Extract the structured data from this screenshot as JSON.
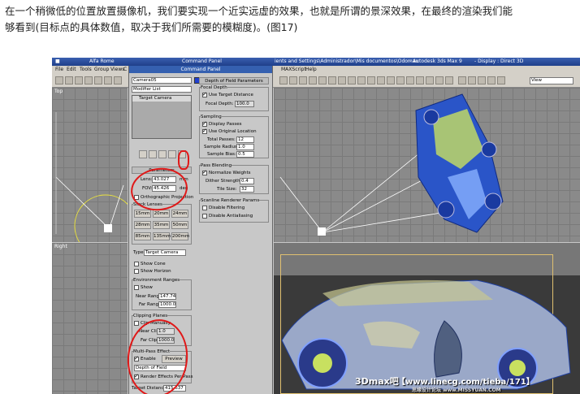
{
  "caption": {
    "line1": "在一个稍微低的位置放置摄像机，我们要实现一个近实远虚的效果，也就是所谓的景深效果，在最终的渲染我们能",
    "line2": "够看到(目标点的具体数值，取决于我们所需要的模糊度)。(图17)"
  },
  "titlebar": {
    "left": "Alfa Rome",
    "center": "Command Panel",
    "right": "ients and Settings\\Administrador\\Mis documentos\\Odomax",
    "app": "- Autodesk 3ds Max 9",
    "display": "- Display : Direct 3D"
  },
  "menubar": {
    "items": [
      "File",
      "Edit",
      "Tools",
      "Group",
      "Views",
      "C"
    ],
    "right_items": [
      "MAXScript",
      "Help"
    ]
  },
  "toolbar": {
    "view_select": "View"
  },
  "viewports": {
    "top": "Top",
    "right": "Right"
  },
  "panel": {
    "object_name": "Camera05",
    "modifier_list": "Modifier List",
    "stack_item": "Target Camera",
    "parameters_header": "Parameters",
    "lens_label": "Lens:",
    "lens_value": "43.027",
    "lens_unit": "mm",
    "fov_label": "FOV:",
    "fov_value": "45.426",
    "fov_unit": "deg",
    "ortho_label": "Orthographic Projection",
    "stock_lenses": "Stock Lenses",
    "lens_buttons": [
      "15mm",
      "20mm",
      "24mm",
      "28mm",
      "35mm",
      "50mm",
      "85mm",
      "135mm",
      "200mm"
    ],
    "type_label": "Type:",
    "type_value": "Target Camera",
    "show_cone": "Show Cone",
    "show_horizon": "Show Horizon",
    "env_ranges": "Environment Ranges",
    "show": "Show",
    "near_range_label": "Near Range:",
    "near_range_value": "147.74",
    "far_range_label": "Far Range:",
    "far_range_value": "1000.0",
    "clipping_planes": "Clipping Planes",
    "clip_manually": "Clip Manually",
    "near_clip_label": "Near Clip:",
    "near_clip_value": "1.0",
    "far_clip_label": "Far Clip:",
    "far_clip_value": "1000.0",
    "multipass": "Multi-Pass Effect",
    "enable": "Enable",
    "preview": "Preview",
    "effect_value": "Depth of Field",
    "render_effects": "Render Effects Per Pass",
    "target_distance_label": "Target Distance:",
    "target_distance_value": "415.637"
  },
  "dof": {
    "header": "Depth of Field Parameters",
    "focal_depth": "Focal Depth",
    "use_target": "Use Target Distance",
    "focal_depth_label": "Focal Depth:",
    "focal_depth_value": "100.0",
    "sampling": "Sampling",
    "display_passes": "Display Passes",
    "use_original": "Use Original Location",
    "total_passes_label": "Total Passes:",
    "total_passes_value": "12",
    "sample_radius_label": "Sample Radius:",
    "sample_radius_value": "1.0",
    "sample_bias_label": "Sample Bias:",
    "sample_bias_value": "0.5",
    "pass_blending": "Pass Blending",
    "normalize_weights": "Normalize Weights",
    "dither_label": "Dither Strength:",
    "dither_value": "0.4",
    "tile_label": "Tile Size:",
    "tile_value": "32",
    "scanline": "Scanline Renderer Params",
    "disable_filtering": "Disable Filtering",
    "disable_antialiasing": "Disable Antialiasing"
  },
  "watermark": {
    "brand": "3Dmax吧",
    "url": "【www.linecg.com/tieba/171】",
    "small": "思缘设计论坛 www.MISSYUAN.COM"
  }
}
